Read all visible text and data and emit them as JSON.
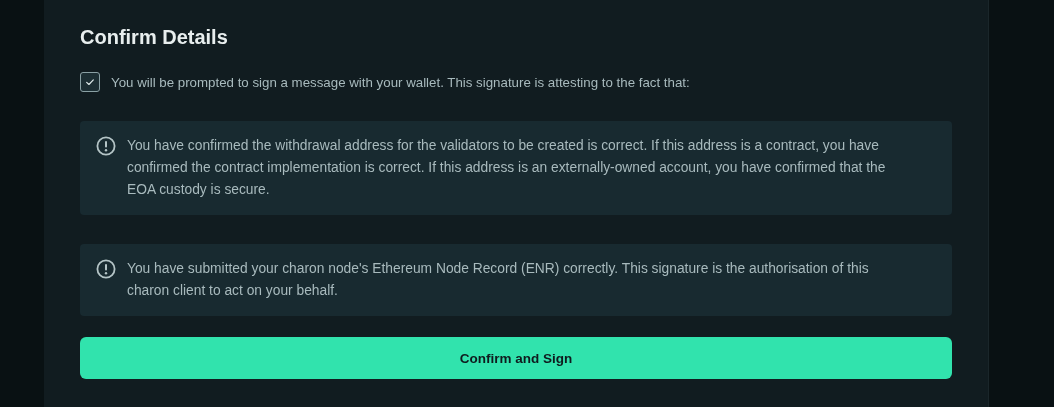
{
  "title": "Confirm Details",
  "agreement": {
    "label": "You will be prompted to sign a message with your wallet. This signature is attesting to the fact that:",
    "checked": true
  },
  "notices": [
    {
      "text": "You have confirmed the withdrawal address for the validators to be created is correct. If this address is a contract, you have confirmed the contract implementation is correct. If this address is an externally-owned account, you have confirmed that the EOA custody is secure."
    },
    {
      "text": "You have submitted your charon node's Ethereum Node Record (ENR) correctly. This signature is the authorisation of this charon client to act on your behalf."
    }
  ],
  "button": {
    "label": "Confirm and Sign"
  }
}
